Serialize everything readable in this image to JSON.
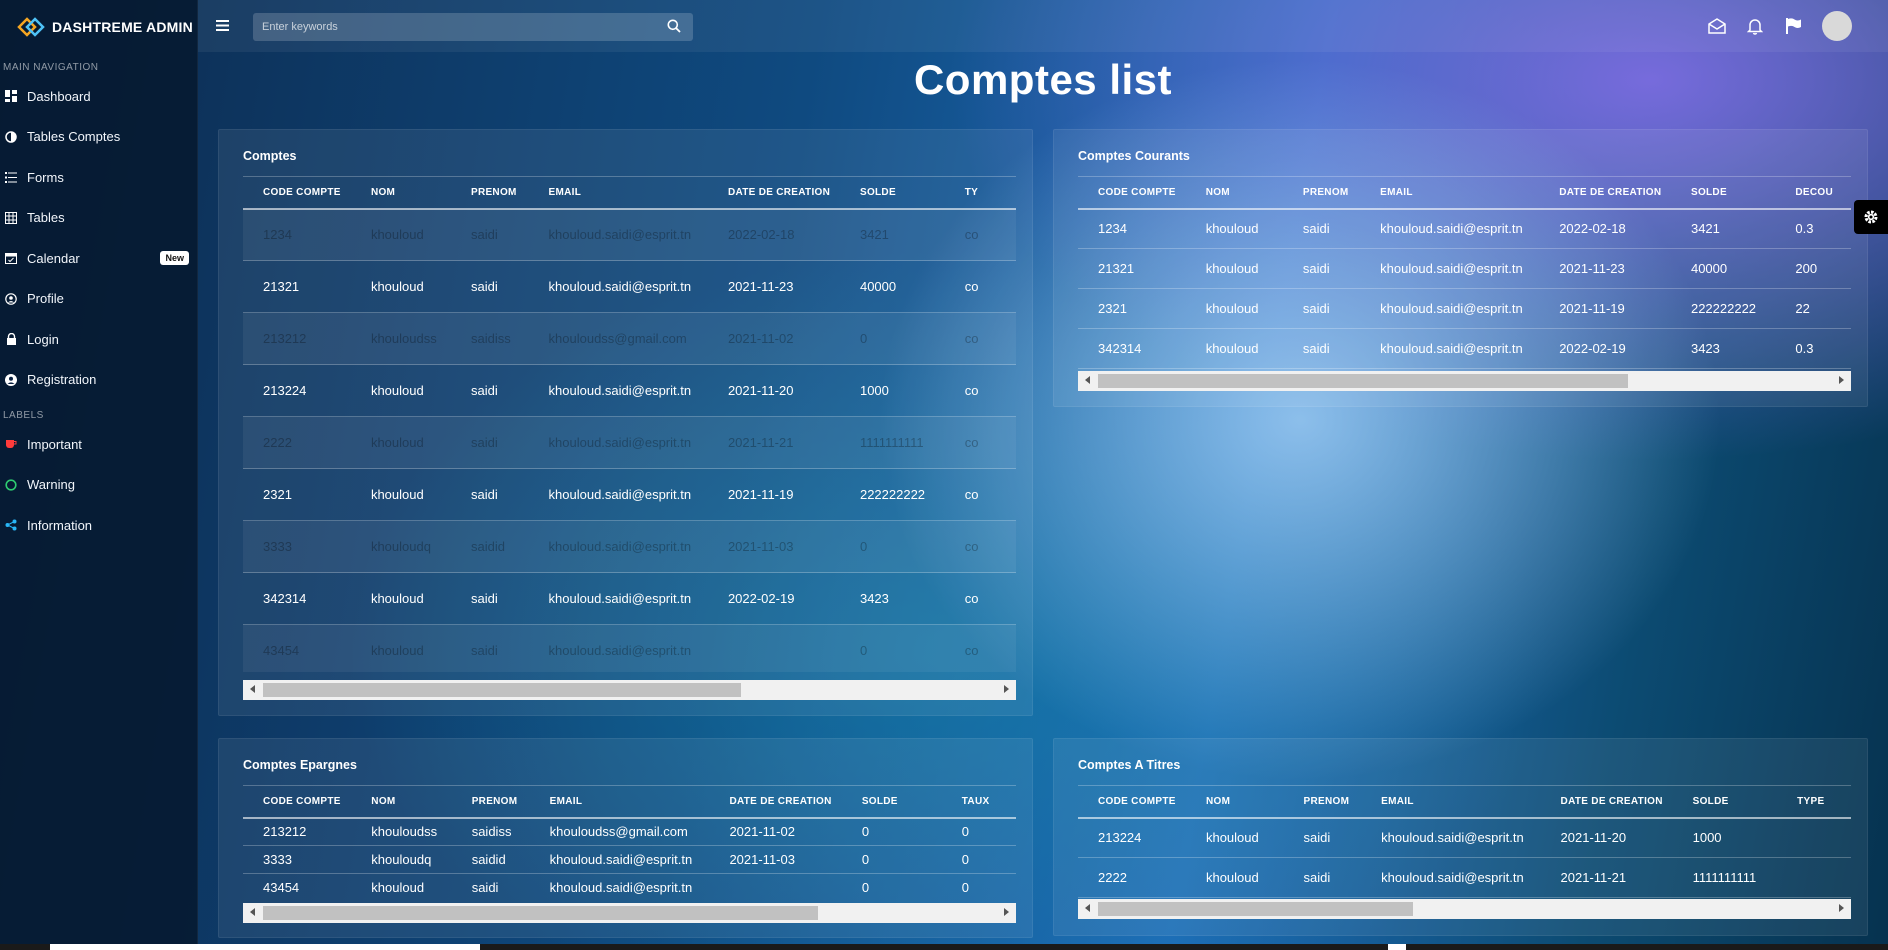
{
  "brand": {
    "name": "DASHTREME ADMIN"
  },
  "sidebar": {
    "main_header": "MAIN NAVIGATION",
    "items": [
      {
        "label": "Dashboard",
        "icon": "dashboard-icon"
      },
      {
        "label": "Tables Comptes",
        "icon": "pie-icon"
      },
      {
        "label": "Forms",
        "icon": "list-icon"
      },
      {
        "label": "Tables",
        "icon": "grid-icon"
      },
      {
        "label": "Calendar",
        "icon": "calendar-icon",
        "badge": "New"
      },
      {
        "label": "Profile",
        "icon": "user-circle-icon"
      },
      {
        "label": "Login",
        "icon": "lock-icon"
      },
      {
        "label": "Registration",
        "icon": "user-icon"
      }
    ],
    "labels_header": "LABELS",
    "labels": [
      {
        "label": "Important",
        "icon": "cup-icon",
        "color": "#ff3b3b"
      },
      {
        "label": "Warning",
        "icon": "circle-icon",
        "color": "#2ecc71"
      },
      {
        "label": "Information",
        "icon": "share-icon",
        "color": "#29b6f6"
      }
    ]
  },
  "search": {
    "placeholder": "Enter keywords"
  },
  "page_title": "Comptes list",
  "cards": {
    "comptes": {
      "title": "Comptes",
      "columns": [
        "CODE COMPTE",
        "NOM",
        "PRENOM",
        "EMAIL",
        "DATE DE CREATION",
        "SOLDE",
        "TY"
      ],
      "rows": [
        [
          "1234",
          "khouloud",
          "saidi",
          "khouloud.saidi@esprit.tn",
          "2022-02-18",
          "3421",
          "co"
        ],
        [
          "21321",
          "khouloud",
          "saidi",
          "khouloud.saidi@esprit.tn",
          "2021-11-23",
          "40000",
          "co"
        ],
        [
          "213212",
          "khouloudss",
          "saidiss",
          "khouloudss@gmail.com",
          "2021-11-02",
          "0",
          "co"
        ],
        [
          "213224",
          "khouloud",
          "saidi",
          "khouloud.saidi@esprit.tn",
          "2021-11-20",
          "1000",
          "co"
        ],
        [
          "2222",
          "khouloud",
          "saidi",
          "khouloud.saidi@esprit.tn",
          "2021-11-21",
          "1111111111",
          "co"
        ],
        [
          "2321",
          "khouloud",
          "saidi",
          "khouloud.saidi@esprit.tn",
          "2021-11-19",
          "222222222",
          "co"
        ],
        [
          "3333",
          "khouloudq",
          "saidid",
          "khouloud.saidi@esprit.tn",
          "2021-11-03",
          "0",
          "co"
        ],
        [
          "342314",
          "khouloud",
          "saidi",
          "khouloud.saidi@esprit.tn",
          "2022-02-19",
          "3423",
          "co"
        ],
        [
          "43454",
          "khouloud",
          "saidi",
          "khouloud.saidi@esprit.tn",
          "",
          "0",
          "co"
        ]
      ]
    },
    "courants": {
      "title": "Comptes Courants",
      "columns": [
        "CODE COMPTE",
        "NOM",
        "PRENOM",
        "EMAIL",
        "DATE DE CREATION",
        "SOLDE",
        "DECOU"
      ],
      "rows": [
        [
          "1234",
          "khouloud",
          "saidi",
          "khouloud.saidi@esprit.tn",
          "2022-02-18",
          "3421",
          "0.3"
        ],
        [
          "21321",
          "khouloud",
          "saidi",
          "khouloud.saidi@esprit.tn",
          "2021-11-23",
          "40000",
          "200"
        ],
        [
          "2321",
          "khouloud",
          "saidi",
          "khouloud.saidi@esprit.tn",
          "2021-11-19",
          "222222222",
          "22"
        ],
        [
          "342314",
          "khouloud",
          "saidi",
          "khouloud.saidi@esprit.tn",
          "2022-02-19",
          "3423",
          "0.3"
        ]
      ]
    },
    "epargnes": {
      "title": "Comptes Epargnes",
      "columns": [
        "CODE COMPTE",
        "NOM",
        "PRENOM",
        "EMAIL",
        "DATE DE CREATION",
        "SOLDE",
        "TAUX"
      ],
      "rows": [
        [
          "213212",
          "khouloudss",
          "saidiss",
          "khouloudss@gmail.com",
          "2021-11-02",
          "0",
          "0"
        ],
        [
          "3333",
          "khouloudq",
          "saidid",
          "khouloud.saidi@esprit.tn",
          "2021-11-03",
          "0",
          "0"
        ],
        [
          "43454",
          "khouloud",
          "saidi",
          "khouloud.saidi@esprit.tn",
          "",
          "0",
          "0"
        ]
      ]
    },
    "titres": {
      "title": "Comptes A Titres",
      "columns": [
        "CODE COMPTE",
        "NOM",
        "PRENOM",
        "EMAIL",
        "DATE DE CREATION",
        "SOLDE",
        "TYPE"
      ],
      "rows": [
        [
          "213224",
          "khouloud",
          "saidi",
          "khouloud.saidi@esprit.tn",
          "2021-11-20",
          "1000",
          ""
        ],
        [
          "2222",
          "khouloud",
          "saidi",
          "khouloud.saidi@esprit.tn",
          "2021-11-21",
          "1111111111",
          ""
        ]
      ]
    }
  }
}
